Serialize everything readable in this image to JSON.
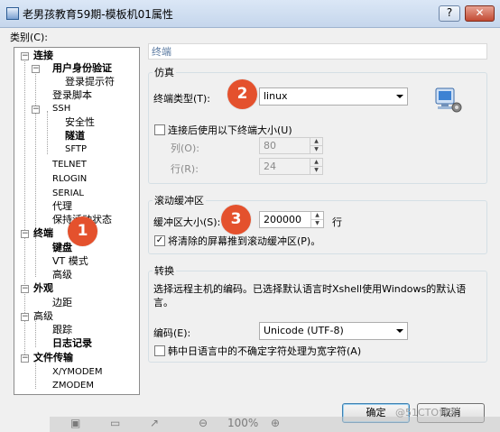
{
  "window": {
    "title": "老男孩教育59期-模板机01属性",
    "help_label": "?",
    "close_label": "✕"
  },
  "category_label": "类别(C):",
  "tree": {
    "connection": "连接",
    "user_auth": "用户身份验证",
    "login_prompt": "登录提示符",
    "login_script": "登录脚本",
    "ssh": "SSH",
    "security": "安全性",
    "tunnel": "隧道",
    "sftp": "SFTP",
    "telnet": "TELNET",
    "rlogin": "RLOGIN",
    "serial": "SERIAL",
    "proxy": "代理",
    "keepalive": "保持活动状态",
    "terminal": "终端",
    "keyboard": "键盘",
    "vt_mode": "VT 模式",
    "advanced_term": "高级",
    "appearance": "外观",
    "margin": "边距",
    "advanced": "高级",
    "trace": "跟踪",
    "logging": "日志记录",
    "file_transfer": "文件传输",
    "xymodem": "X/YMODEM",
    "zmodem": "ZMODEM"
  },
  "panel": {
    "section_title": "终端",
    "emulation": {
      "group_title": "仿真",
      "terminal_type_label": "终端类型(T):",
      "terminal_type_value": "linux",
      "use_size_label": "连接后使用以下终端大小(U)",
      "cols_label": "列(O):",
      "cols_value": "80",
      "rows_label": "行(R):",
      "rows_value": "24"
    },
    "scroll": {
      "group_title": "滚动缓冲区",
      "buffer_label": "缓冲区大小(S):",
      "buffer_value": "200000",
      "buffer_unit": "行",
      "push_cleared_label": "将清除的屏幕推到滚动缓冲区(P)。",
      "push_cleared_checked": true
    },
    "convert": {
      "group_title": "转换",
      "description": "选择远程主机的编码。已选择默认语言时Xshell使用Windows的默认语言。",
      "encoding_label": "编码(E):",
      "encoding_value": "Unicode (UTF-8)",
      "cjk_label": "韩中日语言中的不确定字符处理为宽字符(A)"
    }
  },
  "badges": [
    "1",
    "2",
    "3"
  ],
  "buttons": {
    "ok": "确定",
    "cancel": "取消"
  },
  "bottom_bar": {
    "zoom": "100%"
  },
  "watermark": "@51CTO博客",
  "colors": {
    "badge": "#e4512d",
    "section_title": "#5b7aa1",
    "close_button": "#c24a33"
  }
}
